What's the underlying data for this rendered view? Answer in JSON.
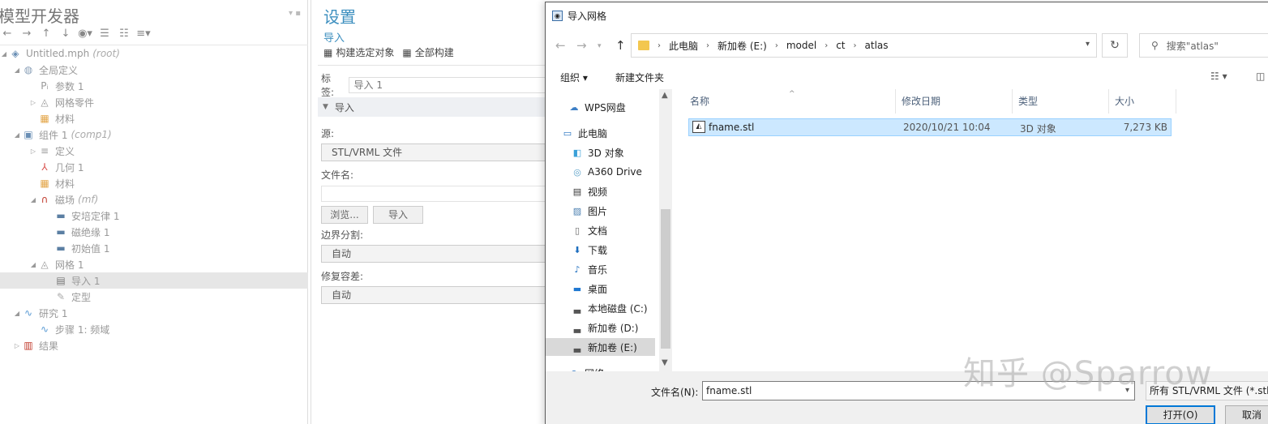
{
  "model_builder": {
    "title": "模型开发器",
    "tree": [
      {
        "label": "Untitled.mph",
        "tag": "(root)",
        "level": 0,
        "arrow": "◢"
      },
      {
        "label": "全局定义",
        "tag": "",
        "level": 1,
        "arrow": "◢"
      },
      {
        "label": "参数 1",
        "tag": "",
        "level": 2,
        "arrow": ""
      },
      {
        "label": "网格零件",
        "tag": "",
        "level": 2,
        "arrow": "▷"
      },
      {
        "label": "材料",
        "tag": "",
        "level": 2,
        "arrow": ""
      },
      {
        "label": "组件 1",
        "tag": "(comp1)",
        "level": 1,
        "arrow": "◢"
      },
      {
        "label": "定义",
        "tag": "",
        "level": 2,
        "arrow": "▷"
      },
      {
        "label": "几何 1",
        "tag": "",
        "level": 2,
        "arrow": ""
      },
      {
        "label": "材料",
        "tag": "",
        "level": 2,
        "arrow": ""
      },
      {
        "label": "磁场",
        "tag": "(mf)",
        "level": 2,
        "arrow": "◢"
      },
      {
        "label": "安培定律 1",
        "tag": "",
        "level": 3,
        "arrow": ""
      },
      {
        "label": "磁绝缘 1",
        "tag": "",
        "level": 3,
        "arrow": ""
      },
      {
        "label": "初始值 1",
        "tag": "",
        "level": 3,
        "arrow": ""
      },
      {
        "label": "网格 1",
        "tag": "",
        "level": 2,
        "arrow": "◢"
      },
      {
        "label": "导入 1",
        "tag": "",
        "level": 3,
        "arrow": "",
        "selected": true
      },
      {
        "label": "定型",
        "tag": "",
        "level": 3,
        "arrow": ""
      },
      {
        "label": "研究 1",
        "tag": "",
        "level": 1,
        "arrow": "◢"
      },
      {
        "label": "步骤 1: 频域",
        "tag": "",
        "level": 2,
        "arrow": ""
      },
      {
        "label": "结果",
        "tag": "",
        "level": 1,
        "arrow": "▷"
      }
    ]
  },
  "settings": {
    "title": "设置",
    "subtitle": "导入",
    "build_selected": "构建选定对象",
    "build_all": "全部构建",
    "label_caption": "标签:",
    "label_value": "导入 1",
    "section_title": "导入",
    "source_label": "源:",
    "source_value": "STL/VRML 文件",
    "filename_label": "文件名:",
    "browse_button": "浏览...",
    "import_button": "导入",
    "boundary_label": "边界分割:",
    "boundary_value": "自动",
    "repair_label": "修复容差:",
    "repair_value": "自动"
  },
  "dialog": {
    "title": "导入网格",
    "breadcrumb": [
      "此电脑",
      "新加卷 (E:)",
      "model",
      "ct",
      "atlas"
    ],
    "search_placeholder": "搜索\"atlas\"",
    "organize": "组织 ▾",
    "new_folder": "新建文件夹",
    "nav_items": [
      {
        "label": "WPS网盘",
        "icon": "cloud-icon"
      },
      {
        "label": "此电脑",
        "icon": "computer-icon"
      },
      {
        "label": "3D 对象",
        "icon": "cube-icon"
      },
      {
        "label": "A360 Drive",
        "icon": "drive-icon"
      },
      {
        "label": "视频",
        "icon": "video-icon"
      },
      {
        "label": "图片",
        "icon": "picture-icon"
      },
      {
        "label": "文档",
        "icon": "document-icon"
      },
      {
        "label": "下载",
        "icon": "download-icon"
      },
      {
        "label": "音乐",
        "icon": "music-icon"
      },
      {
        "label": "桌面",
        "icon": "desktop-icon"
      },
      {
        "label": "本地磁盘 (C:)",
        "icon": "disk-icon"
      },
      {
        "label": "新加卷 (D:)",
        "icon": "disk-icon"
      },
      {
        "label": "新加卷 (E:)",
        "icon": "disk-icon",
        "selected": true
      },
      {
        "label": "网络",
        "icon": "network-icon"
      }
    ],
    "columns": [
      "名称",
      "修改日期",
      "类型",
      "大小"
    ],
    "files": [
      {
        "name": "fname.stl",
        "date": "2020/10/21 10:04",
        "type": "3D 对象",
        "size": "7,273 KB"
      }
    ],
    "filename_label": "文件名(N):",
    "filename_value": "fname.stl",
    "filter_value": "所有 STL/VRML 文件 (*.stl;",
    "open_button": "打开(O)",
    "cancel_button": "取消"
  },
  "watermark": "知乎 @Sparrow"
}
